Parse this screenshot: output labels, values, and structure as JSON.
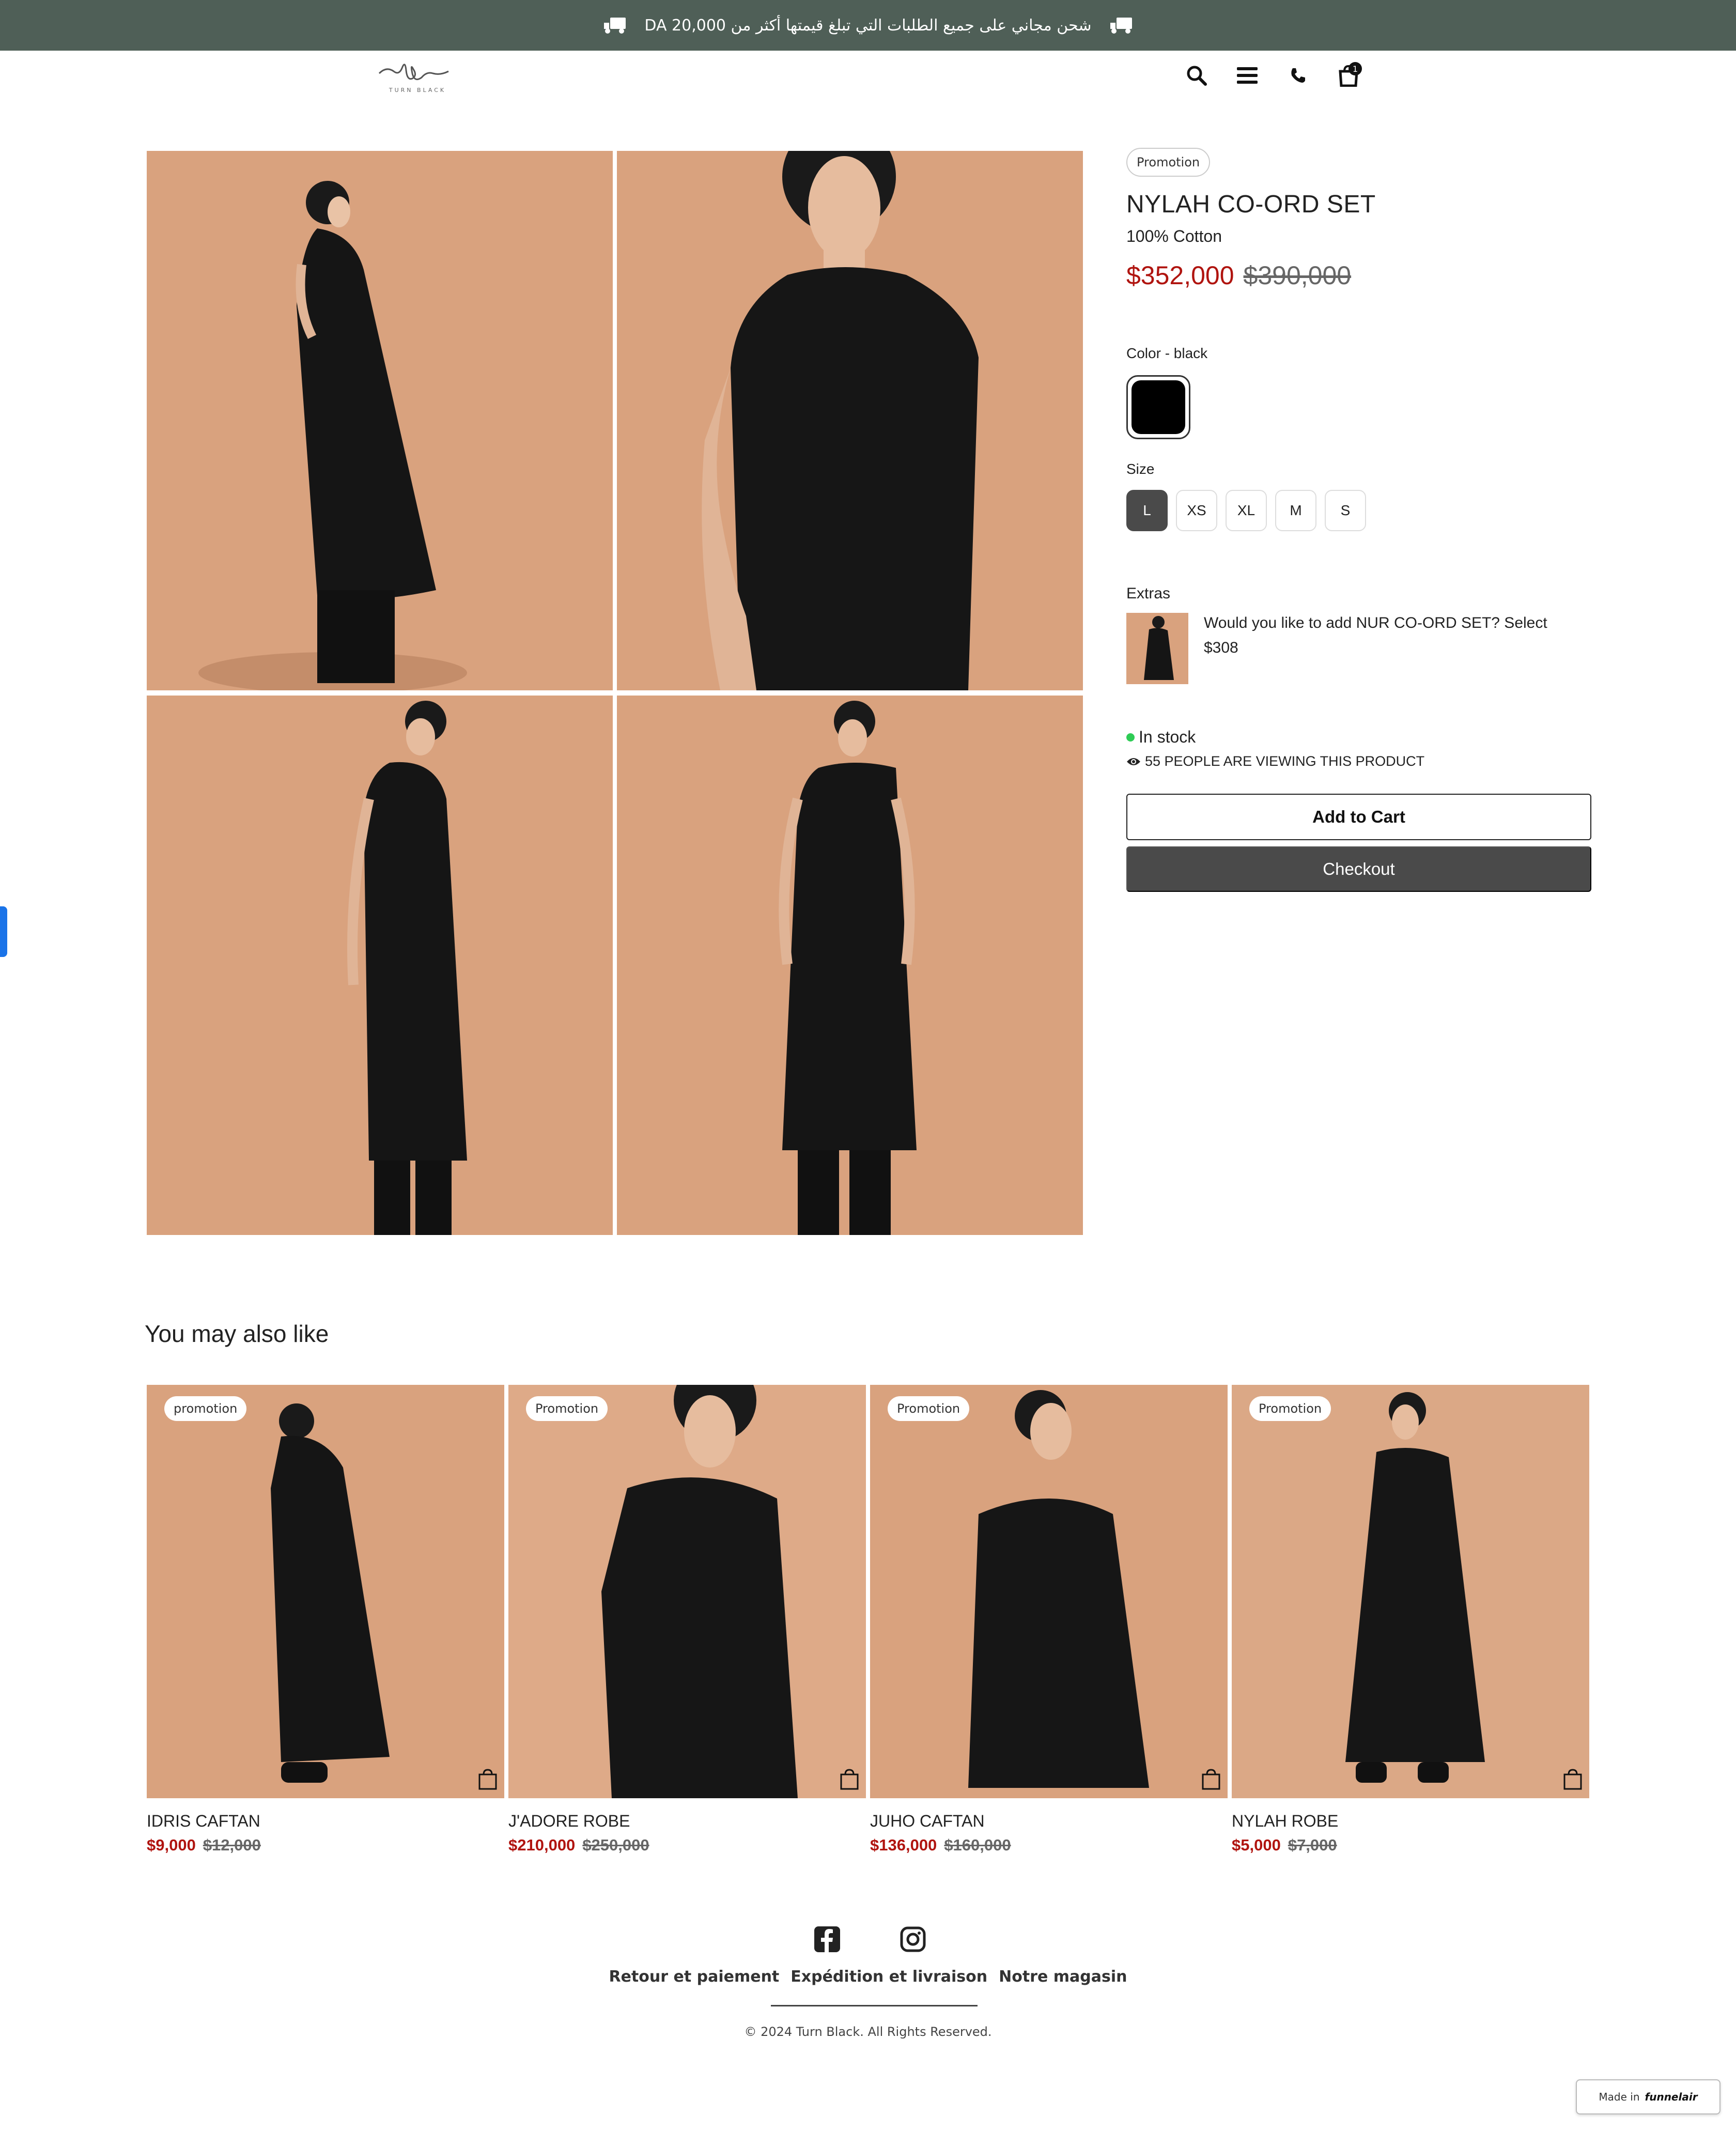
{
  "announcement": {
    "text": "شحن مجاني على جميع الطلبات التي تبلغ قيمتها أكثر من DA 20,000"
  },
  "header": {
    "logo_text": "TURN BLACK",
    "cart_count": "1"
  },
  "product": {
    "badge": "Promotion",
    "title": "NYLAH CO-ORD SET",
    "subtitle": "100% Cotton",
    "price_now": "$352,000",
    "price_old": "$390,000",
    "color_label": "Color - black",
    "size_label": "Size",
    "sizes": [
      "L",
      "XS",
      "XL",
      "M",
      "S"
    ],
    "selected_size": "L",
    "extras_label": "Extras",
    "extra_text": "Would you like to add NUR CO-ORD SET?  Select",
    "extra_price": "$308",
    "stock": "In stock",
    "viewing": "55 PEOPLE ARE VIEWING THIS PRODUCT",
    "add_to_cart": "Add to Cart",
    "checkout": "Checkout"
  },
  "recommendations": {
    "title": "You may also like",
    "items": [
      {
        "badge": "promotion",
        "name": "IDRIS CAFTAN",
        "price_now": "$9,000",
        "price_old": "$12,000"
      },
      {
        "badge": "Promotion",
        "name": "J'ADORE ROBE",
        "price_now": "$210,000",
        "price_old": "$250,000"
      },
      {
        "badge": "Promotion",
        "name": "JUHO CAFTAN",
        "price_now": "$136,000",
        "price_old": "$160,000"
      },
      {
        "badge": "Promotion",
        "name": "NYLAH ROBE",
        "price_now": "$5,000",
        "price_old": "$7,000"
      }
    ]
  },
  "footer": {
    "links": [
      "Retour et paiement",
      "Expédition et livraison",
      "Notre magasin"
    ],
    "copyright": "© 2024 Turn Black. All Rights Reserved.",
    "made_in": "Made in",
    "made_in_brand": "funnelair"
  },
  "colors": {
    "accent_red": "#b0140f",
    "announce_bg": "#4f5f57",
    "backdrop": "#d9a27e",
    "stock_green": "#2ecc55"
  }
}
